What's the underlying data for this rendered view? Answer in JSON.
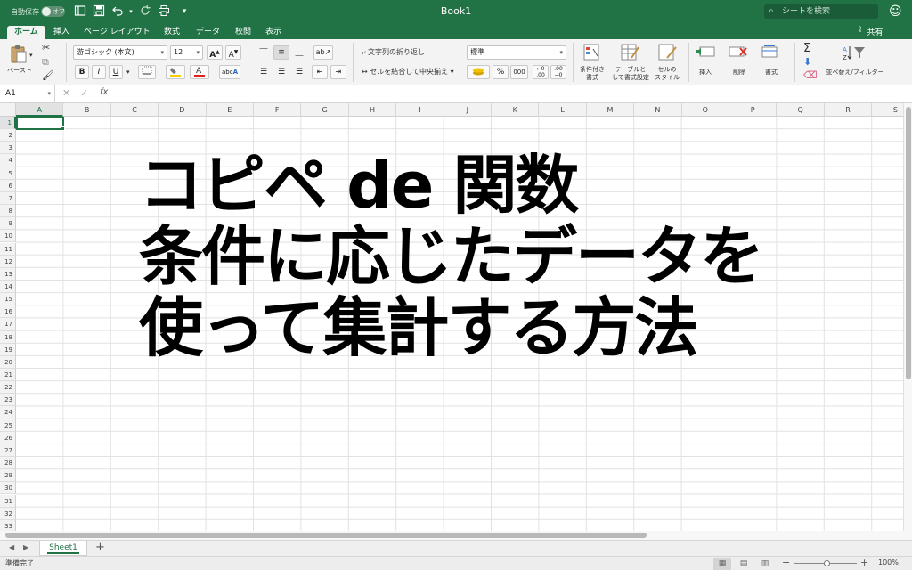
{
  "titlebar": {
    "autosave_label": "自動保存",
    "autosave_state": "オフ",
    "doc_title": "Book1",
    "search_placeholder": "シートを検索",
    "icons": [
      "sidebar-icon",
      "save-icon",
      "undo-icon",
      "redo-icon",
      "print-icon",
      "customize-icon",
      "search-icon",
      "feedback-icon"
    ]
  },
  "tabs": [
    "ホーム",
    "挿入",
    "ページ レイアウト",
    "数式",
    "データ",
    "校閲",
    "表示"
  ],
  "active_tab": "ホーム",
  "share_label": "共有",
  "ribbon": {
    "paste_label": "ペースト",
    "font_name": "游ゴシック (本文)",
    "font_size": "12",
    "bold": "B",
    "italic": "I",
    "underline": "U",
    "wrap_text": "文字列の折り返し",
    "merge_center": "セルを結合して中央揃え",
    "number_format": "標準",
    "percent": "%",
    "comma": "000",
    "cond_format": [
      "条件付き",
      "書式"
    ],
    "table_format": [
      "テーブルと",
      "して書式設定"
    ],
    "cell_style": [
      "セルの",
      "スタイル"
    ],
    "insert": "挿入",
    "delete": "削除",
    "format": "書式",
    "sort_filter": "並べ替え/フィルター"
  },
  "formula_bar": {
    "name_box": "A1",
    "fx": "fx",
    "value": ""
  },
  "grid": {
    "columns": [
      "A",
      "B",
      "C",
      "D",
      "E",
      "F",
      "G",
      "H",
      "I",
      "J",
      "K",
      "L",
      "M",
      "N",
      "O",
      "P",
      "Q",
      "R",
      "S"
    ],
    "rows": [
      "1",
      "2",
      "3",
      "4",
      "5",
      "6",
      "7",
      "8",
      "9",
      "10",
      "11",
      "12",
      "13",
      "14",
      "15",
      "16",
      "17",
      "18",
      "19",
      "20",
      "21",
      "22",
      "23",
      "24",
      "25",
      "26",
      "27",
      "28",
      "29",
      "30",
      "31",
      "32",
      "33"
    ],
    "active_cell": "A1"
  },
  "overlay": {
    "line1": "コピペ de 関数",
    "line2": "条件に応じたデータを",
    "line3": "使って集計する方法"
  },
  "sheets": [
    "Sheet1"
  ],
  "add_sheet": "+",
  "status": {
    "text": "準備完了",
    "zoom": "100%"
  },
  "colors": {
    "accent": "#217346",
    "grid_line": "#e2e2e2"
  }
}
